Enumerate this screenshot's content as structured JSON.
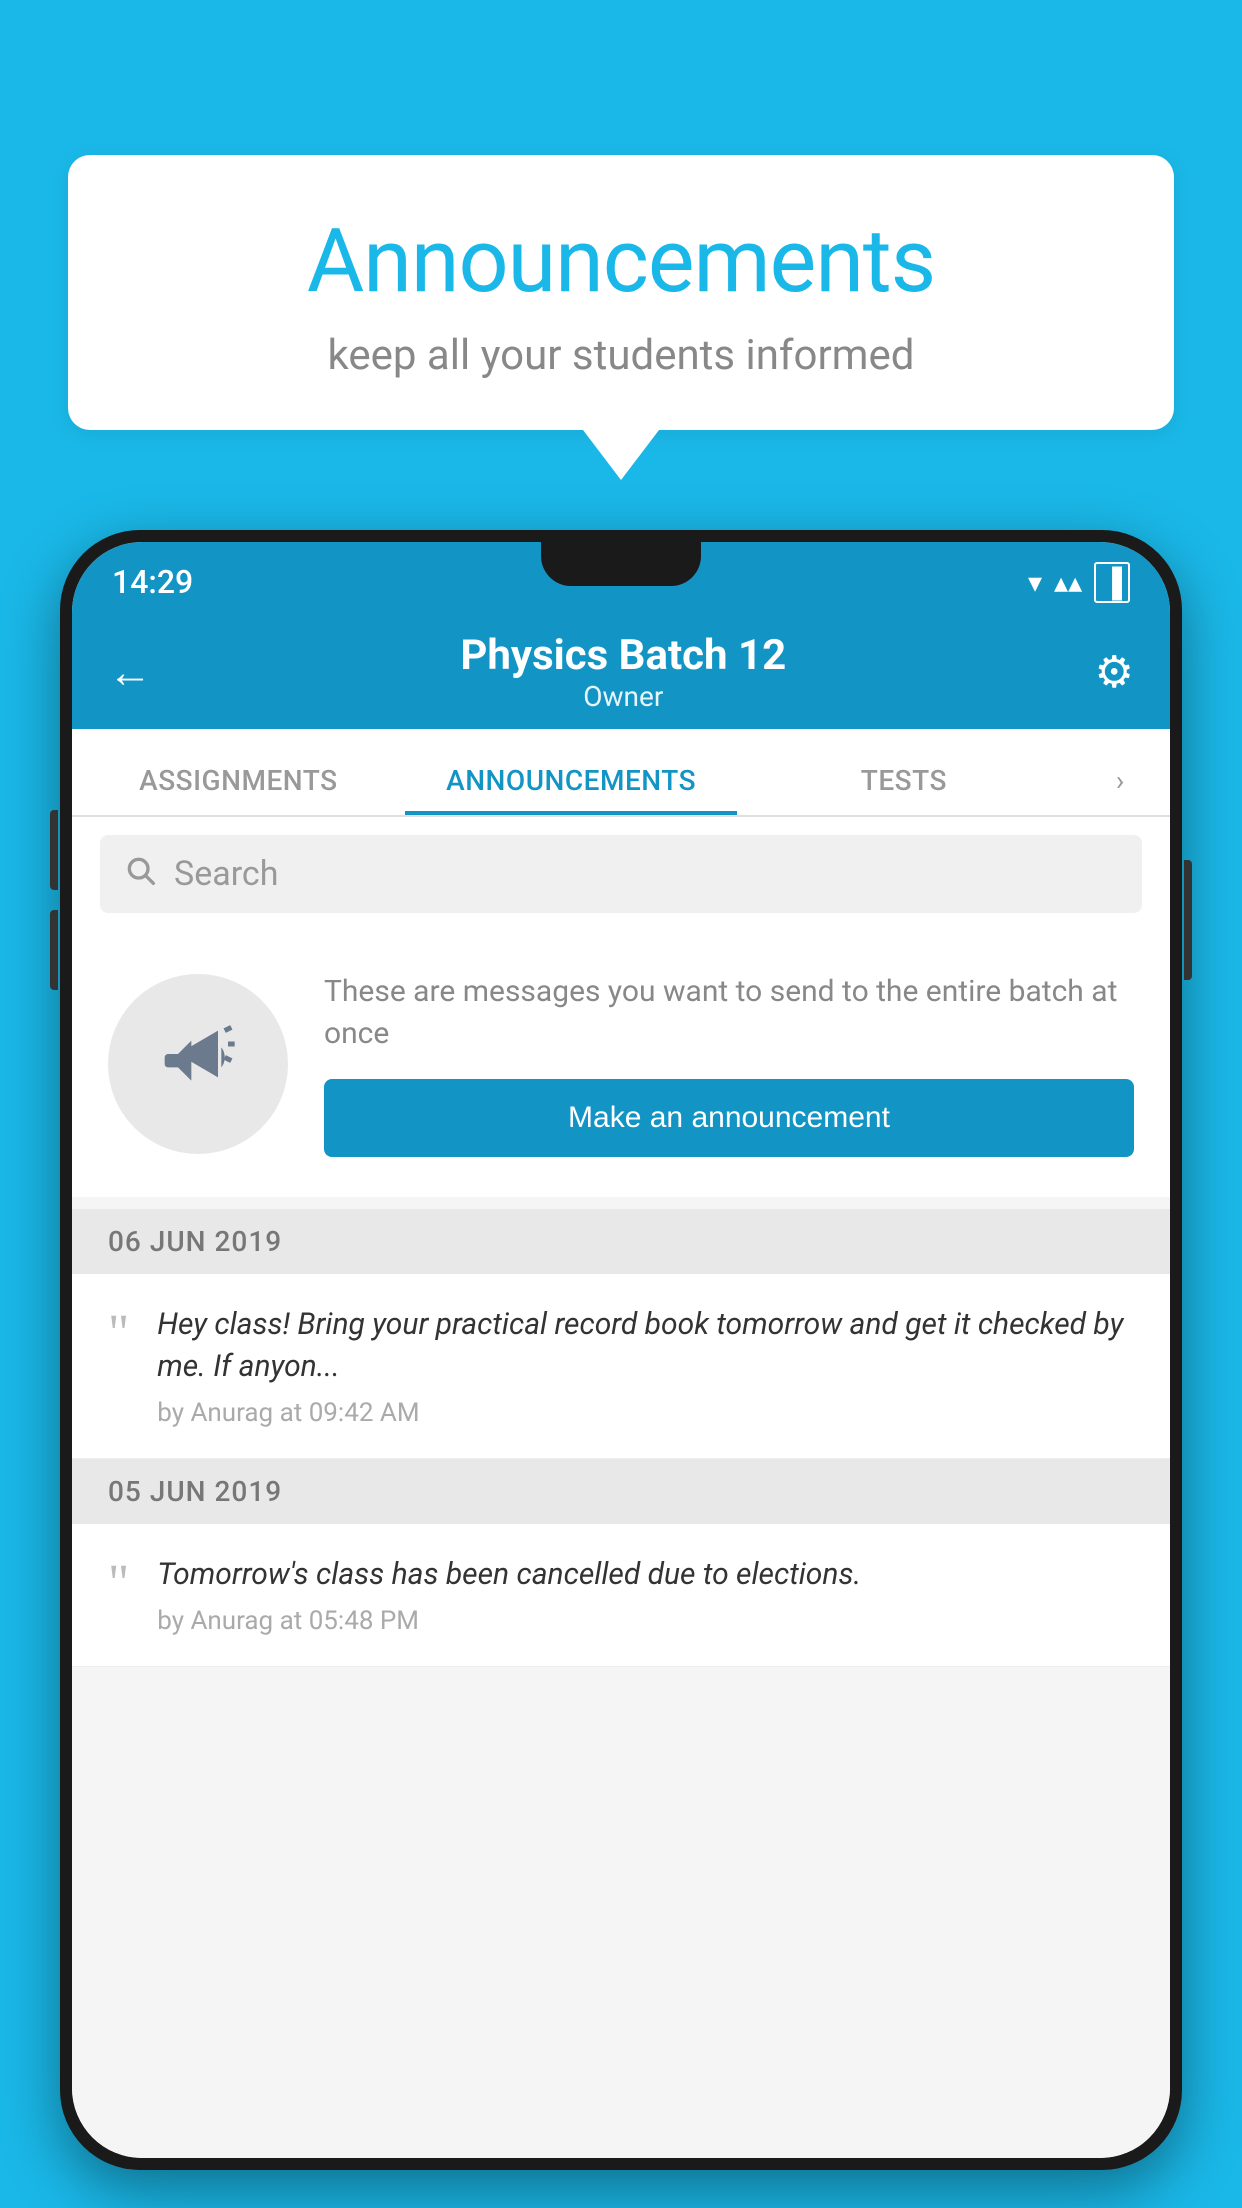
{
  "background_color": "#1ab8e8",
  "speech_bubble": {
    "title": "Announcements",
    "subtitle": "keep all your students informed"
  },
  "status_bar": {
    "time": "14:29",
    "wifi": "▼",
    "signal": "▲",
    "battery": "▐"
  },
  "app_bar": {
    "back_label": "←",
    "title": "Physics Batch 12",
    "subtitle": "Owner",
    "settings_label": "⚙"
  },
  "tabs": [
    {
      "label": "ASSIGNMENTS",
      "active": false
    },
    {
      "label": "ANNOUNCEMENTS",
      "active": true
    },
    {
      "label": "TESTS",
      "active": false
    }
  ],
  "search": {
    "placeholder": "Search"
  },
  "announcement_prompt": {
    "description": "These are messages you want to send to the entire batch at once",
    "button_label": "Make an announcement"
  },
  "dates": [
    {
      "label": "06  JUN  2019",
      "announcements": [
        {
          "message": "Hey class! Bring your practical record book tomorrow and get it checked by me. If anyon...",
          "meta": "by Anurag at 09:42 AM"
        }
      ]
    },
    {
      "label": "05  JUN  2019",
      "announcements": [
        {
          "message": "Tomorrow's class has been cancelled due to elections.",
          "meta": "by Anurag at 05:48 PM"
        }
      ]
    }
  ]
}
